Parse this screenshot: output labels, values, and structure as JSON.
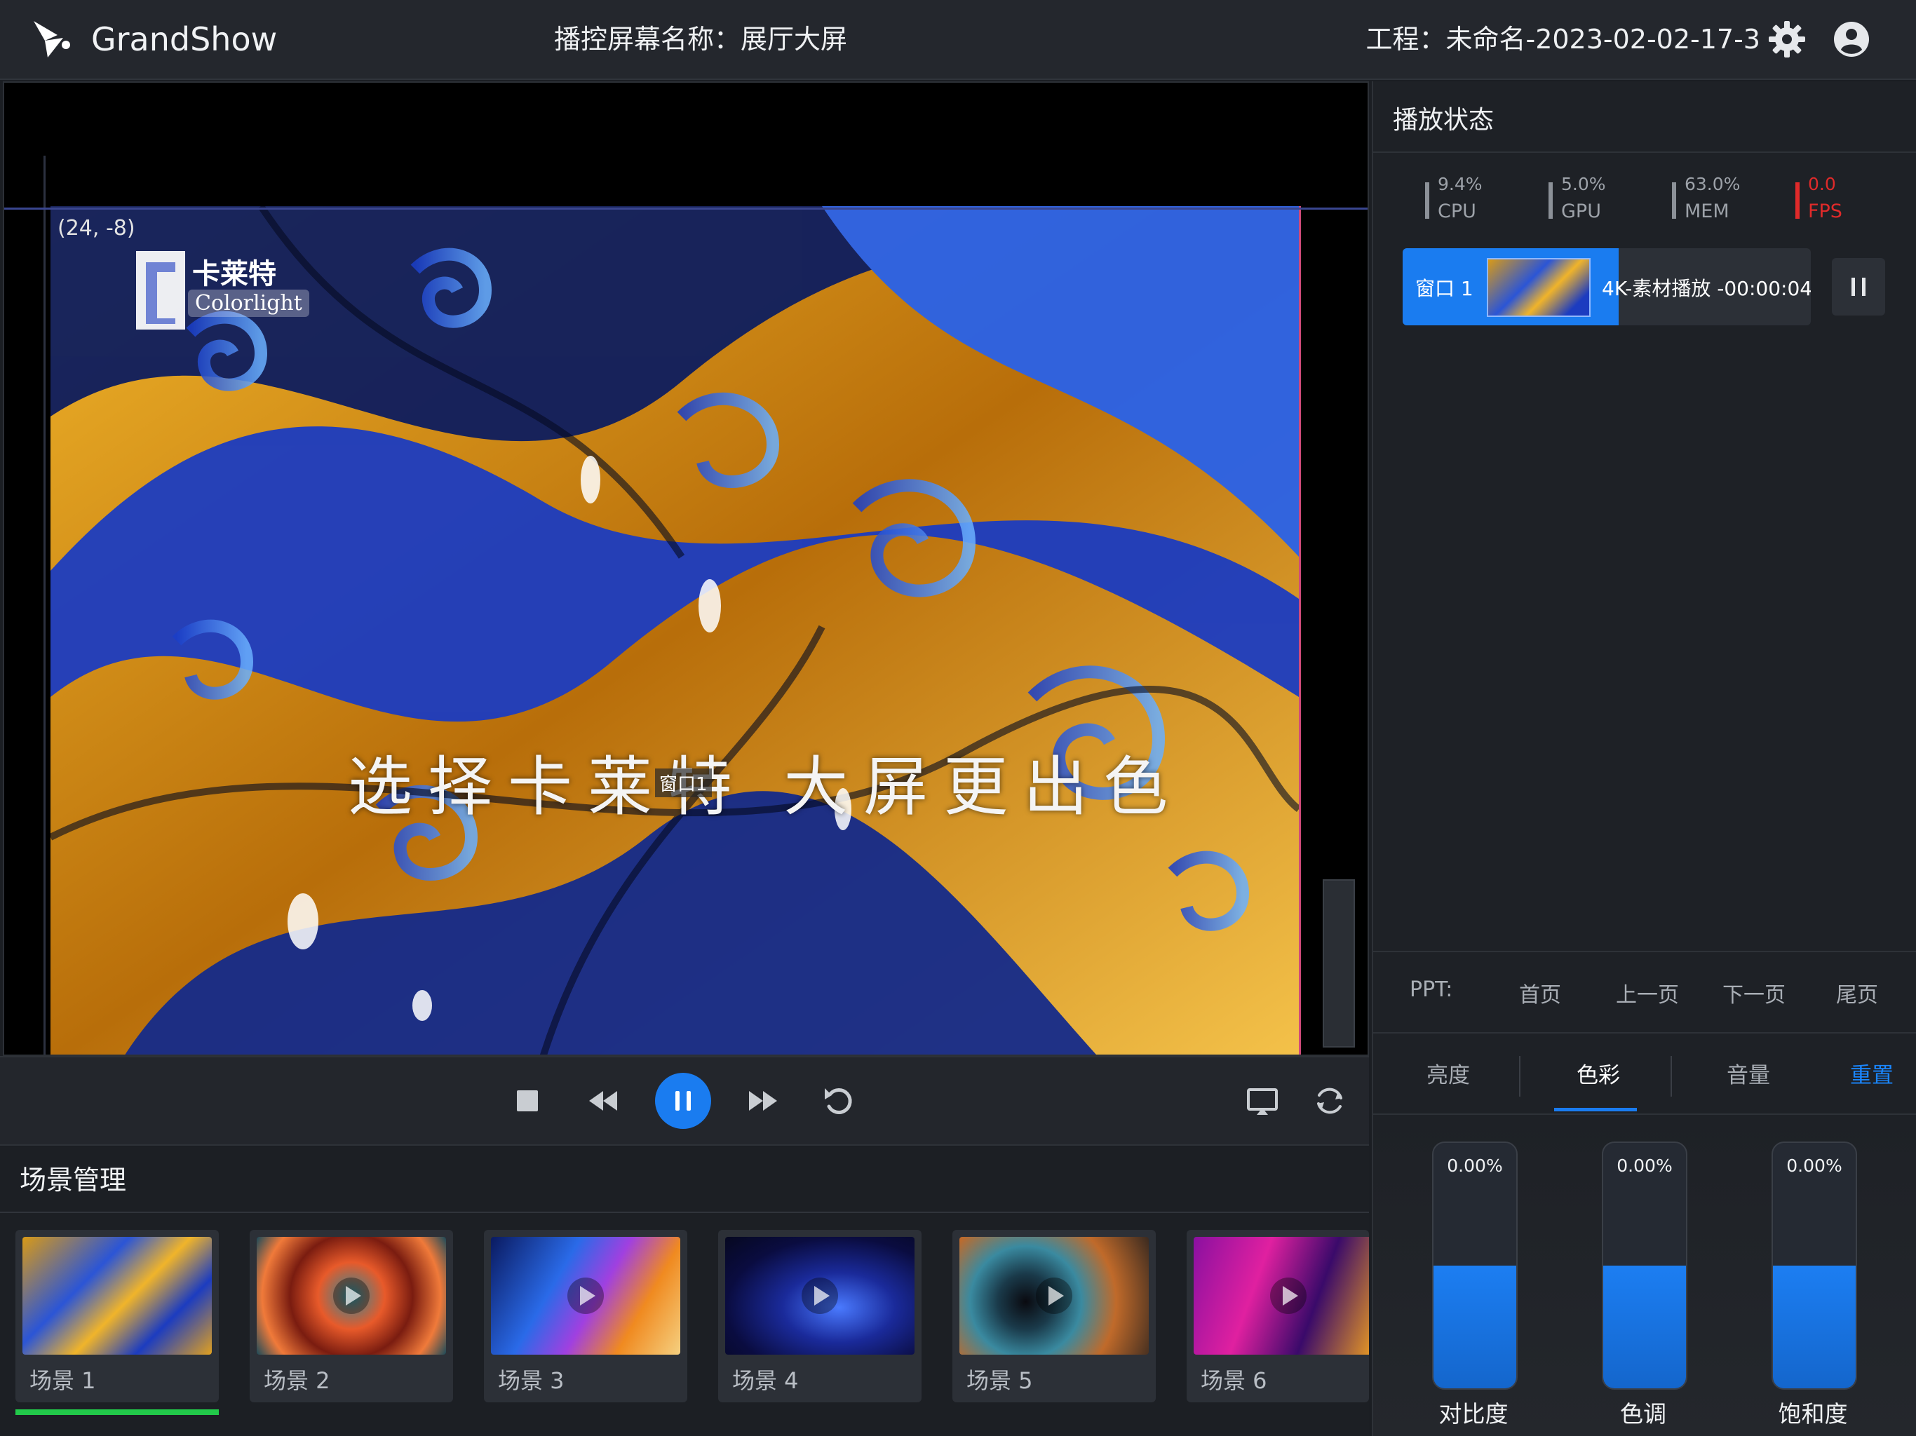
{
  "app": {
    "name": "GrandShow"
  },
  "header": {
    "screen_label": "播控屏幕名称：展厅大屏",
    "project_label": "工程：未命名-2023-02-02-17-3"
  },
  "preview": {
    "coord_readout": "(24, -8)",
    "brand_cn": "卡莱特",
    "brand_en": "Colorlight",
    "slogan": "选择卡莱特 大屏更出色",
    "window_tag": "窗口1"
  },
  "scenes": {
    "title": "场景管理",
    "items": [
      {
        "label": "场景 1",
        "active": true
      },
      {
        "label": "场景 2"
      },
      {
        "label": "场景 3"
      },
      {
        "label": "场景 4"
      },
      {
        "label": "场景 5"
      },
      {
        "label": "场景 6"
      }
    ]
  },
  "status": {
    "title": "播放状态",
    "metrics": [
      {
        "value": "9.4%",
        "label": "CPU"
      },
      {
        "value": "5.0%",
        "label": "GPU"
      },
      {
        "value": "63.0%",
        "label": "MEM"
      },
      {
        "value": "0.0",
        "label": "FPS"
      }
    ],
    "playing": {
      "window": "窗口 1",
      "text": "4K-素材播放  -00:00:04",
      "progress_fraction": 0.53
    }
  },
  "ppt": {
    "label": "PPT:",
    "first": "首页",
    "prev": "上一页",
    "next": "下一页",
    "last": "尾页"
  },
  "adjust": {
    "tabs": [
      "亮度",
      "色彩",
      "音量"
    ],
    "active_tab": "色彩",
    "reset": "重置",
    "sliders": [
      {
        "value": "0.00%",
        "label": "对比度",
        "level": 0.5
      },
      {
        "value": "0.00%",
        "label": "色调",
        "level": 0.5
      },
      {
        "value": "0.00%",
        "label": "饱和度",
        "level": 0.5
      }
    ]
  },
  "colors": {
    "accent": "#1a7cf0",
    "fps_alert": "#e02a2a",
    "scene_active": "#22c94a",
    "background": "#1b1e23"
  }
}
